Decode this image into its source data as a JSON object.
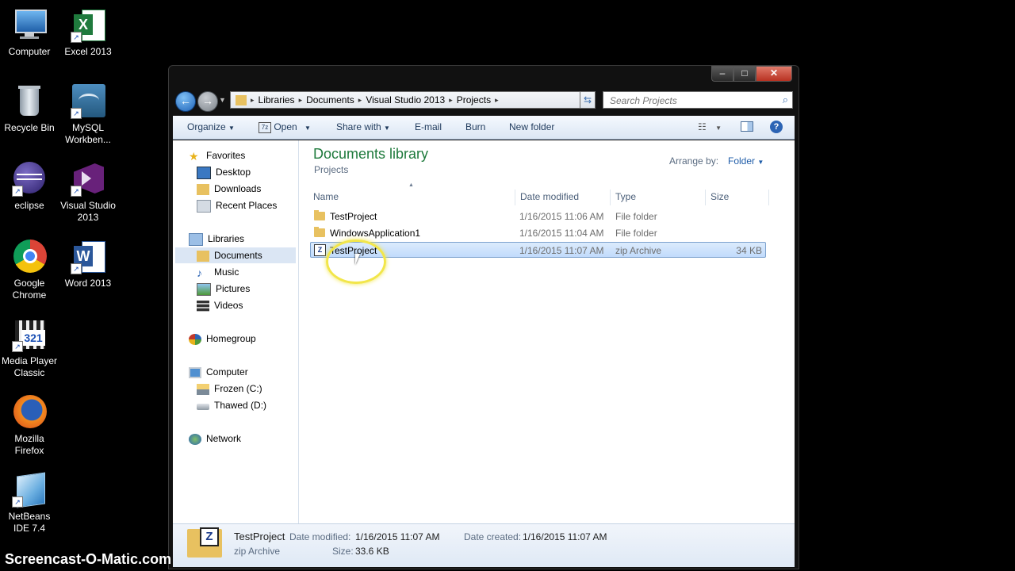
{
  "desktop": {
    "icons": [
      {
        "label": "Computer",
        "icon": "computer-icon"
      },
      {
        "label": "Excel 2013",
        "icon": "excel-icon"
      },
      {
        "label": "Recycle Bin",
        "icon": "recycle-bin-icon"
      },
      {
        "label": "MySQL Workben...",
        "icon": "mysql-icon"
      },
      {
        "label": "eclipse",
        "icon": "eclipse-icon"
      },
      {
        "label": "Visual Studio 2013",
        "icon": "visual-studio-icon"
      },
      {
        "label": "Google Chrome",
        "icon": "chrome-icon"
      },
      {
        "label": "Word 2013",
        "icon": "word-icon"
      },
      {
        "label": "Media Player Classic",
        "icon": "media-player-icon"
      },
      {
        "label": "Mozilla Firefox",
        "icon": "firefox-icon"
      },
      {
        "label": "NetBeans IDE 7.4",
        "icon": "netbeans-icon"
      }
    ]
  },
  "window": {
    "caption_buttons": {
      "minimize": "‒",
      "maximize": "□",
      "close": "✕"
    },
    "address": {
      "crumbs": [
        "Libraries",
        "Documents",
        "Visual Studio 2013",
        "Projects"
      ]
    },
    "search": {
      "placeholder": "Search Projects"
    },
    "toolbar": {
      "organize": "Organize",
      "open": "Open",
      "share_with": "Share with",
      "email": "E-mail",
      "burn": "Burn",
      "new_folder": "New folder"
    },
    "nav": {
      "favorites": "Favorites",
      "desktop": "Desktop",
      "downloads": "Downloads",
      "recent_places": "Recent Places",
      "libraries": "Libraries",
      "documents": "Documents",
      "music": "Music",
      "pictures": "Pictures",
      "videos": "Videos",
      "homegroup": "Homegroup",
      "computer": "Computer",
      "drive_c": "Frozen (C:)",
      "drive_d": "Thawed (D:)",
      "network": "Network"
    },
    "library": {
      "title": "Documents library",
      "subtitle": "Projects",
      "arrange_by_label": "Arrange by:",
      "arrange_by_value": "Folder"
    },
    "columns": {
      "name": "Name",
      "date": "Date modified",
      "type": "Type",
      "size": "Size"
    },
    "files": [
      {
        "name": "TestProject",
        "date": "1/16/2015 11:06 AM",
        "type": "File folder",
        "size": "",
        "kind": "folder"
      },
      {
        "name": "WindowsApplication1",
        "date": "1/16/2015 11:04 AM",
        "type": "File folder",
        "size": "",
        "kind": "folder"
      },
      {
        "name": "TestProject",
        "date": "1/16/2015 11:07 AM",
        "type": "zip Archive",
        "size": "34 KB",
        "kind": "zip"
      }
    ],
    "details": {
      "name": "TestProject",
      "type": "zip Archive",
      "date_modified_label": "Date modified:",
      "date_modified": "1/16/2015 11:07 AM",
      "date_created_label": "Date created:",
      "date_created": "1/16/2015 11:07 AM",
      "size_label": "Size:",
      "size": "33.6 KB"
    }
  },
  "watermark": "Screencast-O-Matic.com",
  "colors": {
    "library_title": "#1e7a3c",
    "accent_link": "#1e5ca8",
    "selection": "#c1dbfc"
  }
}
